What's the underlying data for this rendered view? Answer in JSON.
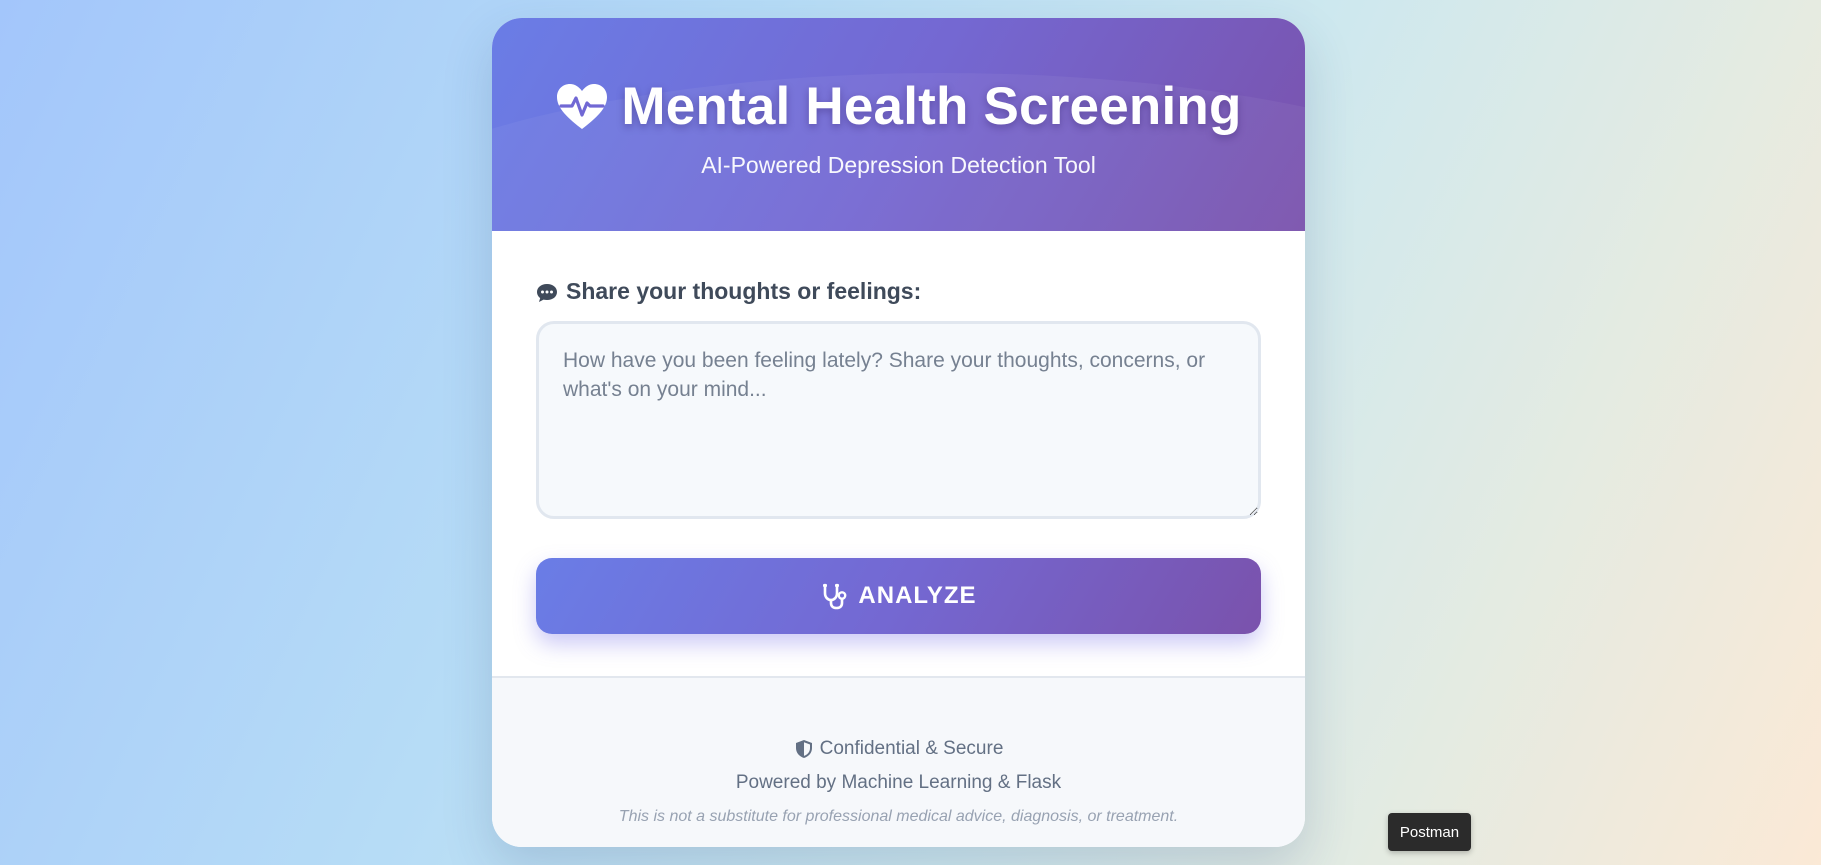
{
  "header": {
    "title": "Mental Health Screening",
    "subtitle": "AI-Powered Depression Detection Tool",
    "icon": "heart-pulse-icon"
  },
  "form": {
    "label": "Share your thoughts or feelings:",
    "label_icon": "chat-icon",
    "placeholder": "How have you been feeling lately? Share your thoughts, concerns, or what's on your mind...",
    "value": "",
    "analyze_label": "ANALYZE",
    "analyze_icon": "stethoscope-icon"
  },
  "footer": {
    "secure_text": "Confidential & Secure",
    "secure_icon": "shield-icon",
    "powered_text": "Powered by Machine Learning & Flask",
    "disclaimer": "This is not a substitute for professional medical advice, diagnosis, or treatment."
  },
  "tooltip": {
    "text": "Postman"
  },
  "colors": {
    "gradient_start": "#667eea",
    "gradient_end": "#764ba2",
    "label_text": "#3f4a5a",
    "footer_text": "#637084",
    "disclaimer_text": "#98a2b2"
  }
}
